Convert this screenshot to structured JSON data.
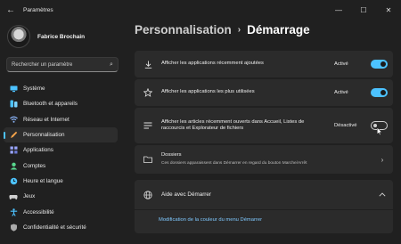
{
  "window": {
    "back_icon": "arrow-left-icon",
    "title": "Paramètres",
    "controls": [
      "minimize-icon",
      "maximize-icon",
      "close-icon"
    ]
  },
  "user": {
    "name": "Fabrice Brochain"
  },
  "search": {
    "placeholder": "Rechercher un paramètre"
  },
  "nav": {
    "items": [
      {
        "label": "Système",
        "icon": "monitor-icon",
        "color": "#4cc2ff"
      },
      {
        "label": "Bluetooth et appareils",
        "icon": "bluetooth-icon",
        "color": "#4cc2ff"
      },
      {
        "label": "Réseau et Internet",
        "icon": "wifi-icon",
        "color": "#8ab4f8"
      },
      {
        "label": "Personnalisation",
        "icon": "pen-icon",
        "color": "#f7a44a",
        "active": true
      },
      {
        "label": "Applications",
        "icon": "apps-icon",
        "color": "#9aa6ff"
      },
      {
        "label": "Comptes",
        "icon": "person-icon",
        "color": "#58d68d"
      },
      {
        "label": "Heure et langue",
        "icon": "globe-clock-icon",
        "color": "#4cc2ff"
      },
      {
        "label": "Jeux",
        "icon": "gamepad-icon",
        "color": "#cfcfcf"
      },
      {
        "label": "Accessibilité",
        "icon": "accessibility-icon",
        "color": "#4cc2ff"
      },
      {
        "label": "Confidentialité et sécurité",
        "icon": "shield-icon",
        "color": "#aaaaaa"
      }
    ]
  },
  "breadcrumb": {
    "parent": "Personnalisation",
    "separator": "›",
    "current": "Démarrage"
  },
  "settings": {
    "recent_apps": {
      "label": "Afficher les applications récemment ajoutées",
      "state": "Activé",
      "on": true
    },
    "most_used": {
      "label": "Afficher les applications les plus utilisées",
      "state": "Activé",
      "on": true
    },
    "recent_items": {
      "label": "Afficher les articles récemment ouverts dans Accueil, Listes de raccourcis et Explorateur de fichiers",
      "state": "Désactivé",
      "on": false
    },
    "folders": {
      "label": "Dossiers",
      "sub": "Ces dossiers apparaissent dans Démarrer en regard du bouton Marche/Arrêt"
    }
  },
  "help": {
    "title": "Aide avec Démarrer",
    "link": "Modification de la couleur du menu Démarrer"
  },
  "colors": {
    "accent": "#4cc2ff",
    "background": "#202020",
    "card": "#2b2b2b"
  }
}
